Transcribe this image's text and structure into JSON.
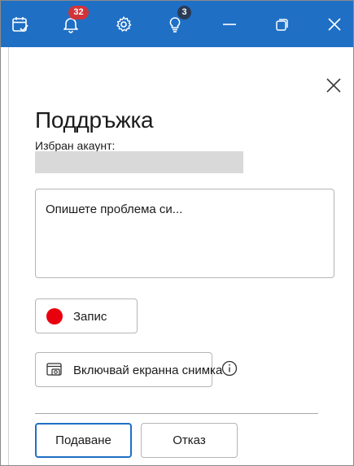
{
  "titlebar": {
    "background": "#1f6fc5",
    "icons": {
      "calendar": "calendar-check-icon",
      "notifications": "bell-icon",
      "settings": "gear-icon",
      "tips": "lightbulb-icon",
      "minimize": "minimize-icon",
      "restore": "restore-icon",
      "close": "close-icon"
    },
    "notification_count": "32",
    "tips_count": "3"
  },
  "panel": {
    "title": "Поддръжка",
    "account_label": "Избран акаунт:",
    "description_placeholder": "Опишете проблема си...",
    "record_label": "Запис",
    "screenshot_label": "Включвай екранна снимка",
    "submit_label": "Подаване",
    "cancel_label": "Отказ"
  },
  "colors": {
    "accent": "#1f6fc5",
    "record_dot": "#e8000e",
    "badge_red": "#d13438"
  }
}
